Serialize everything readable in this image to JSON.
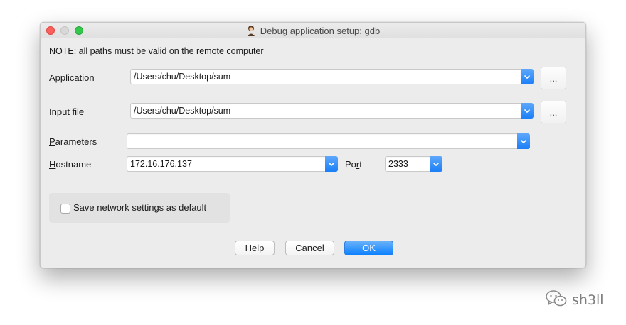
{
  "window": {
    "title": "Debug application setup: gdb"
  },
  "note": "NOTE: all paths must be valid on the remote computer",
  "form": {
    "application": {
      "label_mnemonic": "A",
      "label_rest": "pplication",
      "value": "/Users/chu/Desktop/sum",
      "browse_label": "..."
    },
    "input_file": {
      "label_mnemonic": "I",
      "label_rest": "nput file",
      "value": "/Users/chu/Desktop/sum",
      "browse_label": "..."
    },
    "parameters": {
      "label_mnemonic": "P",
      "label_rest": "arameters",
      "value": ""
    },
    "hostname": {
      "label_mnemonic": "H",
      "label_rest": "ostname",
      "value": "172.16.176.137"
    },
    "port": {
      "label_prefix": "Po",
      "label_mnemonic": "r",
      "label_rest": "t",
      "value": "2333"
    }
  },
  "save_default": {
    "label": "Save network settings as default",
    "checked": false
  },
  "buttons": {
    "help": "Help",
    "cancel": "Cancel",
    "ok": "OK"
  },
  "watermark": {
    "text": "sh3ll",
    "icon": "wechat-icon"
  },
  "colors": {
    "accent": "#1a7ff7",
    "close": "#fc605c",
    "minimize": "#d8d8d8",
    "maximize": "#34c84a"
  }
}
